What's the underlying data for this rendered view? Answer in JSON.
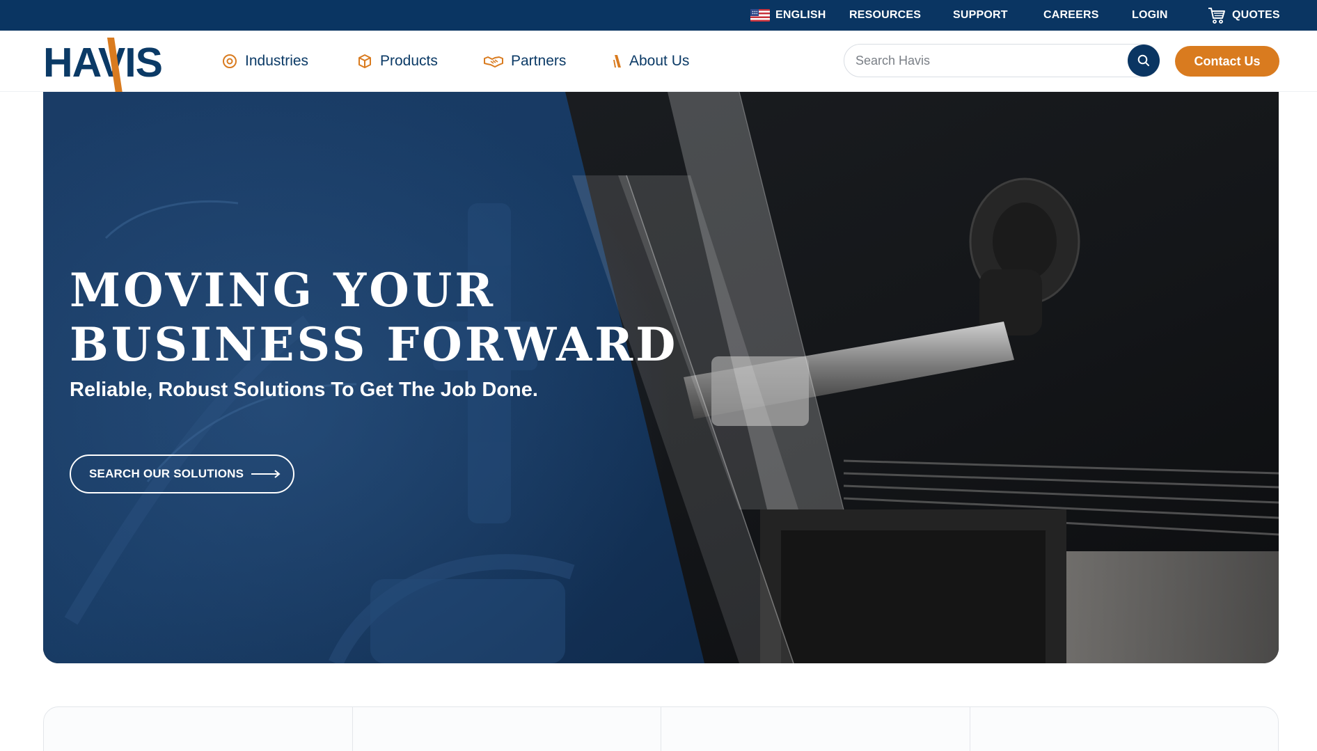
{
  "utility_bar": {
    "language": "ENGLISH",
    "resources": "RESOURCES",
    "support": "SUPPORT",
    "careers": "CAREERS",
    "login": "LOGIN",
    "quotes": "QUOTES"
  },
  "brand": {
    "logo_text": "HAVIS",
    "primary_color": "#0a3562",
    "accent_color": "#d97b1f"
  },
  "nav": {
    "items": [
      {
        "label": "Industries",
        "icon": "target-icon"
      },
      {
        "label": "Products",
        "icon": "box-icon"
      },
      {
        "label": "Partners",
        "icon": "handshake-icon"
      },
      {
        "label": "About Us",
        "icon": "havis-mark-icon"
      }
    ],
    "search_placeholder": "Search Havis",
    "contact_label": "Contact Us"
  },
  "hero": {
    "title_line1": "MOVING YOUR",
    "title_line2": "BUSINESS FORWARD",
    "subtitle": "Reliable, Robust Solutions To Get The Job Done.",
    "cta_label": "SEARCH OUR SOLUTIONS"
  },
  "cards": {
    "count": 4
  }
}
